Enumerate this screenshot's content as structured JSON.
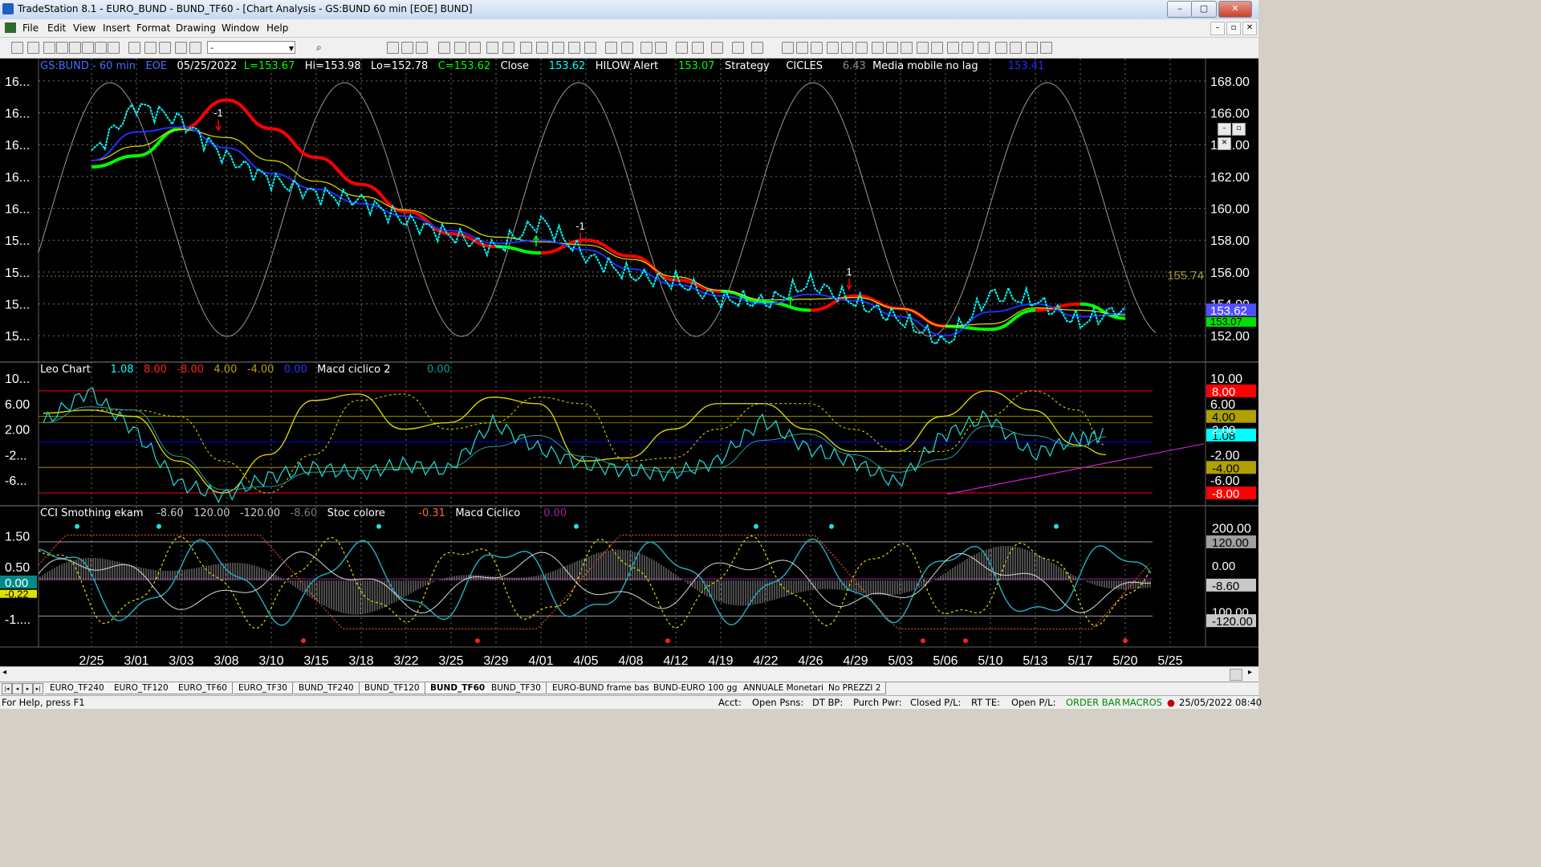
{
  "window": {
    "title": "TradeStation 8.1 - EURO_BUND - BUND_TF60 - [Chart Analysis - GS:BUND  60 min  [EOE] BUND]",
    "min_label": "–",
    "max_label": "▢",
    "close_label": "✕"
  },
  "menu": [
    "File",
    "Edit",
    "View",
    "Insert",
    "Format",
    "Drawing",
    "Window",
    "Help"
  ],
  "toolbar": {
    "combo_value": "-"
  },
  "colors": {
    "bg": "#000000",
    "price": "#00ffff",
    "blue": "#1f2fff",
    "red": "#ff0000",
    "green": "#00ff00",
    "yellow": "#e0e000",
    "grid": "#6f6f6f"
  },
  "price_panel": {
    "symbol": "GS:BUND - 60 min",
    "session": "EOE",
    "date": "05/25/2022",
    "low_reading": "L=153.67",
    "hi": "Hi=153.98",
    "lo": "Lo=152.78",
    "close_reading": "C=153.62",
    "close_label": "Close",
    "close_val": "153.62",
    "hilow_label": "HILOW Alert",
    "hilow_val": "153.07",
    "strategy": "Strategy",
    "cicles": "CICLES",
    "cicles_val": "6.43",
    "media_label": "Media mobile no lag",
    "media_val": "153.41",
    "left_ticks": [
      "16...",
      "16...",
      "16...",
      "16...",
      "16...",
      "15...",
      "15...",
      "15...",
      "15..."
    ],
    "right_ticks": [
      "168.00",
      "166.00",
      "164.00",
      "162.00",
      "160.00",
      "158.00",
      "156.00",
      "154.00",
      "152.00"
    ],
    "level_label": "155.74",
    "badge_close": "153.62",
    "badge_hilow": "153.07",
    "trade_labels": [
      "-1",
      "-1",
      "1"
    ]
  },
  "panel2": {
    "name": "Leo Chart",
    "v1": "1.08",
    "v2": "8.00",
    "v3": "-8.00",
    "v4": "4.00",
    "v5": "-4.00",
    "v6": "0.00",
    "macd_label": "Macd ciclico 2",
    "macd_val": "0.00",
    "left_ticks": [
      "10...",
      "6.00",
      "2.00",
      "-2...",
      "-6..."
    ],
    "right_ticks": [
      "10.00",
      "6.00",
      "-2.00",
      "-6.00"
    ],
    "badges": [
      "8.00",
      "4.00",
      "1.08",
      "-4.00",
      "-8.00"
    ],
    "overlap_tick": "2.00"
  },
  "panel3": {
    "name": "CCI Smothing ekam",
    "v1": "-8.60",
    "v2": "120.00",
    "v3": "-120.00",
    "v4": "-8.60",
    "stoc_label": "Stoc colore",
    "stoc_val": "-0.31",
    "macd_label": "Macd Ciclico",
    "macd_val": "0.00",
    "left_ticks": [
      "1.50",
      "0.50",
      "-1...."
    ],
    "left_badges": [
      "0.00",
      "-0.22"
    ],
    "right_ticks": [
      "200.00",
      "100.00"
    ],
    "right_badges": [
      "120.00",
      "-8.60",
      "-120.00"
    ],
    "overlap_tick": "0.00"
  },
  "x_axis": [
    "2/25",
    "3/01",
    "3/03",
    "3/08",
    "3/10",
    "3/15",
    "3/18",
    "3/22",
    "3/25",
    "3/29",
    "4/01",
    "4/05",
    "4/08",
    "4/12",
    "4/19",
    "4/22",
    "4/26",
    "4/29",
    "5/03",
    "5/06",
    "5/10",
    "5/13",
    "5/17",
    "5/20",
    "5/25"
  ],
  "tabs": [
    "EURO_TF240",
    "EURO_TF120",
    "EURO_TF60",
    "EURO_TF30",
    "BUND_TF240",
    "BUND_TF120",
    "BUND_TF60",
    "BUND_TF30",
    "EURO-BUND frame bassi",
    "BUND-EURO 100 gg",
    "ANNUALE Monetari",
    "No PREZZI 2"
  ],
  "active_tab": "BUND_TF60",
  "status": {
    "help": "For Help, press F1",
    "acct": "Acct:",
    "open_psns": "Open Psns:",
    "dt_bp": "DT BP:",
    "purch_pwr": "Purch Pwr:",
    "closed_pl": "Closed P/L:",
    "rt_te": "RT TE:",
    "open_pl": "Open P/L:",
    "order_bar": "ORDER BAR",
    "macros": "MACROS",
    "datetime": "25/05/2022 08:40"
  },
  "chart_data": [
    {
      "type": "line",
      "x": [
        "2/25",
        "3/01",
        "3/03",
        "3/08",
        "3/10",
        "3/15",
        "3/18",
        "3/22",
        "3/25",
        "3/29",
        "4/01",
        "4/05",
        "4/08",
        "4/12",
        "4/19",
        "4/22",
        "4/26",
        "4/29",
        "5/03",
        "5/06",
        "5/10",
        "5/13",
        "5/17",
        "5/20"
      ],
      "series": [
        {
          "name": "Close",
          "values": [
            163.4,
            166.5,
            165.5,
            163.2,
            161.8,
            160.9,
            160.5,
            159.2,
            158.3,
            157.5,
            159.2,
            157.0,
            155.8,
            155.4,
            154.3,
            154.1,
            155.3,
            154.1,
            153.0,
            151.5,
            154.6,
            154.2,
            152.8,
            153.8
          ]
        },
        {
          "name": "Media mobile no lag",
          "values": [
            163.0,
            164.8,
            165.1,
            163.8,
            162.2,
            161.2,
            160.3,
            159.5,
            158.6,
            157.8,
            158.0,
            157.4,
            156.2,
            155.2,
            154.5,
            154.0,
            154.6,
            154.2,
            153.2,
            152.0,
            153.5,
            154.0,
            153.2,
            153.4
          ]
        },
        {
          "name": "HILOW Alert",
          "values": [
            162.6,
            163.3,
            165.0,
            166.8,
            165.0,
            163.2,
            161.5,
            159.8,
            158.4,
            157.6,
            157.2,
            158.0,
            157.0,
            155.5,
            154.8,
            154.1,
            153.6,
            154.5,
            153.7,
            152.6,
            152.4,
            153.6,
            154.0,
            153.1
          ]
        }
      ],
      "ylim": [
        150.5,
        169.0
      ]
    },
    {
      "type": "line",
      "x": [
        "2/25",
        "3/01",
        "3/03",
        "3/08",
        "3/10",
        "3/15",
        "3/18",
        "3/22",
        "3/25",
        "3/29",
        "4/01",
        "4/05",
        "4/08",
        "4/12",
        "4/19",
        "4/22",
        "4/26",
        "4/29",
        "5/03",
        "5/06",
        "5/10",
        "5/13",
        "5/17",
        "5/20",
        "5/25"
      ],
      "series": [
        {
          "name": "Leo Chart",
          "values": [
            3.0,
            8.0,
            2.0,
            -6.5,
            -8.5,
            -5.5,
            -4.0,
            -5.0,
            -3.5,
            -4.5,
            3.0,
            -1.0,
            -3.5,
            -4.5,
            -5.0,
            -3.0,
            3.5,
            -1.0,
            -3.0,
            -6.5,
            1.0,
            4.0,
            -2.0,
            0.5,
            1.08
          ]
        },
        {
          "name": "Macd ciclico 2",
          "values": [
            4.5,
            5.0,
            4.0,
            -3.0,
            -8.0,
            -2.0,
            6.5,
            7.5,
            2.0,
            3.0,
            7.0,
            6.0,
            -3.0,
            -2.5,
            2.0,
            6.0,
            6.0,
            2.0,
            -1.5,
            -1.5,
            4.0,
            8.0,
            5.0,
            -0.5,
            -2.0
          ]
        }
      ],
      "ylim": [
        -9.0,
        10.5
      ]
    }
  ]
}
